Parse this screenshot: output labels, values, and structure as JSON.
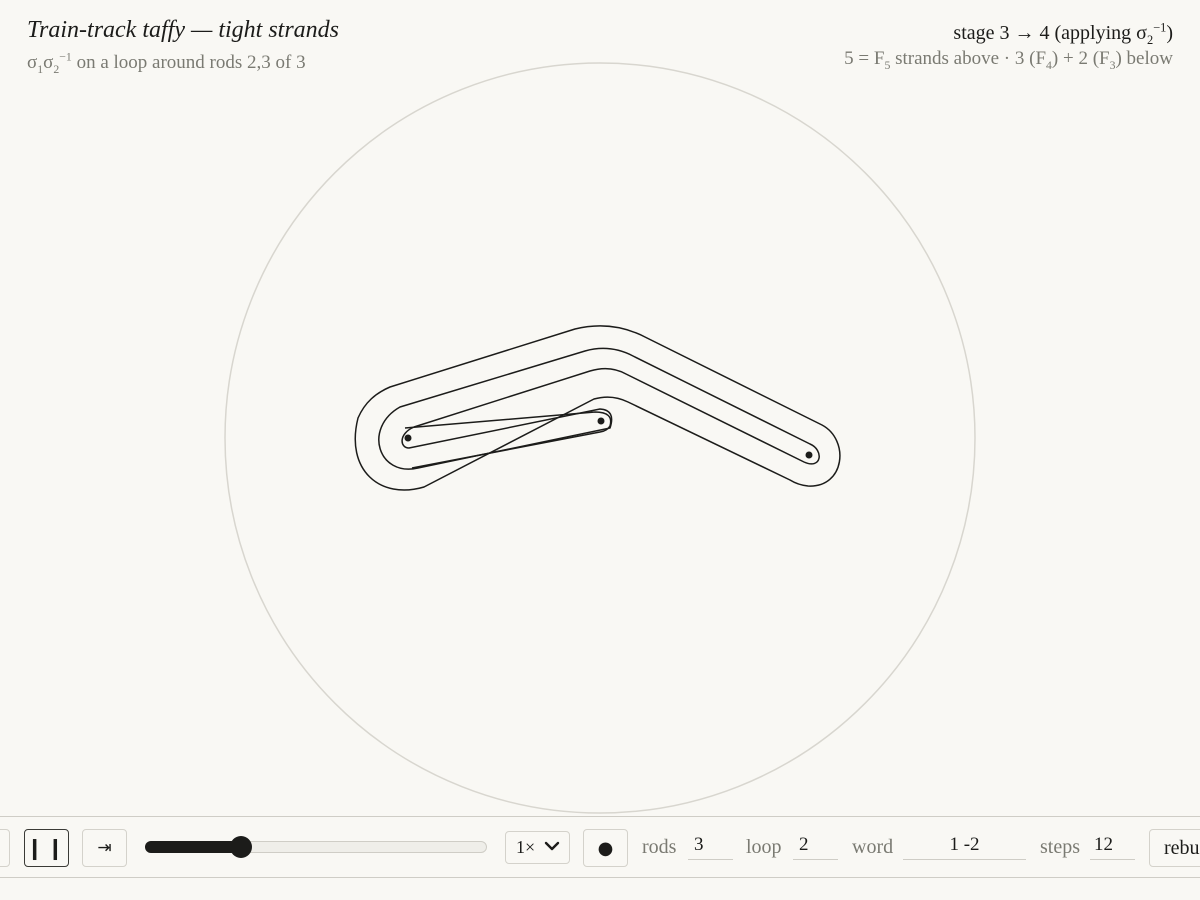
{
  "header": {
    "title": "Train-track taffy — tight strands",
    "subtitle": {
      "s1": "σ",
      "s1_sub": "1",
      "s2": "σ",
      "s2_sub": "2",
      "s2_sup": "−1",
      "rest": " on a loop around rods 2,3 of 3"
    }
  },
  "status": {
    "stage_text": "stage 3 → 4  (applying σ",
    "stage_sub": "2",
    "stage_sup": "−1",
    "stage_close": ")",
    "count_a": "5 = F",
    "count_a_sub": "5",
    "count_b": " strands above · 3 (F",
    "count_b_sub": "4",
    "count_c": ") + 2 (F",
    "count_c_sub": "3",
    "count_d": ") below"
  },
  "toolbar": {
    "pause_label": "❙❙",
    "step_label": "⇥",
    "progress": 0.28,
    "speed": "1×",
    "dot_label": "●",
    "rods_label": "rods",
    "rods_value": "3",
    "loop_label": "loop",
    "loop_value": "2",
    "word_label": "word",
    "word_value": "1 -2",
    "steps_label": "steps",
    "steps_value": "12",
    "rebuild_label": "rebuild"
  },
  "colors": {
    "background": "#f9f8f4",
    "ink": "#1c1c1a",
    "muted": "#7a7a72",
    "rule": "#cfcdc6"
  },
  "icons": {
    "pause": "pause-icon",
    "step": "step-forward-icon",
    "speed_chevron": "chevron-down-icon",
    "dot": "dot-icon"
  }
}
